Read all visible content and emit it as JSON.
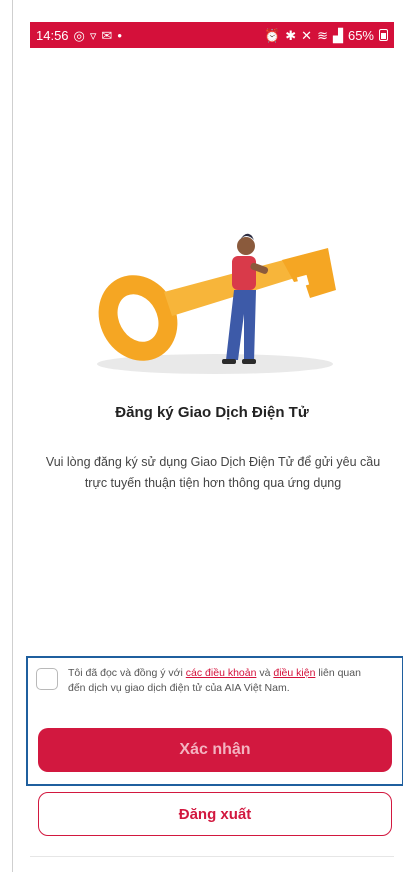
{
  "status_bar": {
    "time": "14:56",
    "left_icons": [
      "whatsapp-icon",
      "notification-icon",
      "app-icon",
      "dot-icon"
    ],
    "right_icons": [
      "alarm-icon",
      "bluetooth-icon",
      "mute-icon",
      "wifi-icon",
      "signal-icon"
    ],
    "battery": "65%"
  },
  "main": {
    "illustration": "person-carrying-key-illustration",
    "title": "Đăng ký Giao Dịch Điện Tử",
    "description": "Vui lòng đăng ký sử dụng Giao Dịch Điện Tử để gửi yêu cầu trực tuyến thuận tiện hơn thông qua ứng dụng"
  },
  "consent": {
    "checked": false,
    "text_before": "Tôi đã đọc và đồng ý với ",
    "link_terms": "các điều khoản",
    "text_and": " và ",
    "link_conditions": "điều kiện",
    "text_after": " liên quan đến dịch vụ giao dịch điện tử của AIA Việt Nam."
  },
  "buttons": {
    "confirm_label": "Xác nhận",
    "logout_label": "Đăng xuất"
  },
  "colors": {
    "brand_red": "#d2183f",
    "highlight_border": "#1f5f9e",
    "key_orange": "#f5a623"
  }
}
